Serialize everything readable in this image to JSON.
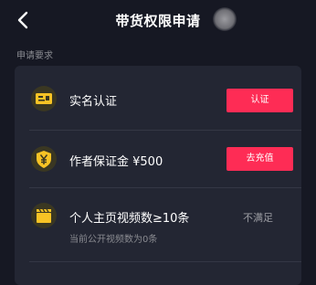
{
  "header": {
    "back_icon": "chevron-left-icon",
    "title": "带货权限申请"
  },
  "section": {
    "label": "申请要求"
  },
  "requirements": [
    {
      "icon": "id-card-icon",
      "label": "实名认证",
      "action_label": "认证"
    },
    {
      "icon": "yen-shield-icon",
      "label": "作者保证金 ¥500",
      "action_label": "去充值"
    },
    {
      "icon": "video-clapper-icon",
      "label": "个人主页视频数≥10条",
      "status": "不满足",
      "sub": "当前公开视频数为0条"
    }
  ],
  "colors": {
    "background": "#161823",
    "card": "#232633",
    "accent": "#fe2c55",
    "icon_yellow": "#f7c325",
    "muted_text": "#8a8b91"
  }
}
